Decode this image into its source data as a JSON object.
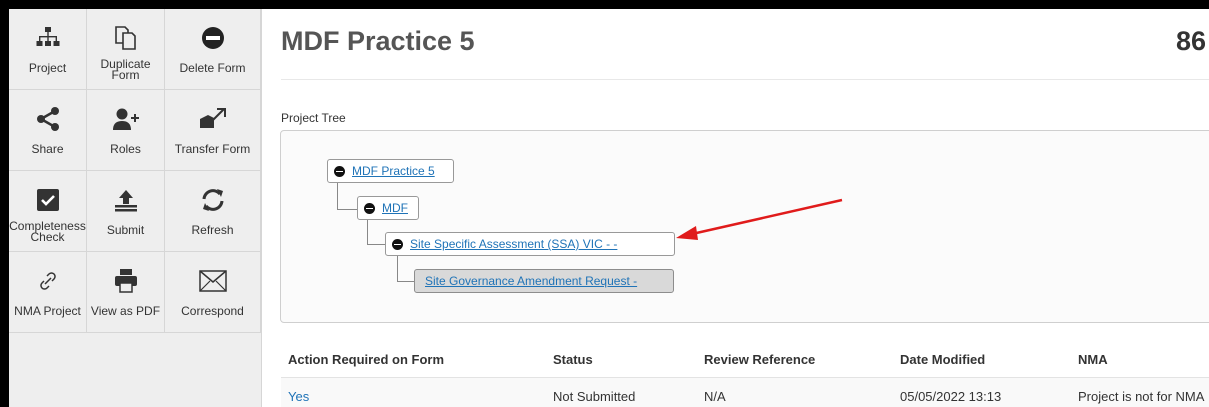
{
  "toolbar": {
    "project": "Project",
    "duplicate_line1": "Duplicate",
    "duplicate_line2": "Form",
    "delete_form": "Delete Form",
    "share": "Share",
    "roles": "Roles",
    "transfer_form": "Transfer Form",
    "completeness_line1": "Completeness",
    "completeness_line2": "Check",
    "submit": "Submit",
    "refresh": "Refresh",
    "nma_project": "NMA Project",
    "view_as_pdf": "View as PDF",
    "correspond": "Correspond"
  },
  "header": {
    "title": "MDF Practice 5",
    "number_partial": "86"
  },
  "project_tree": {
    "label": "Project Tree",
    "nodes": [
      {
        "label": "MDF Practice 5"
      },
      {
        "label": "MDF"
      },
      {
        "label": "Site Specific Assessment (SSA) VIC - -"
      },
      {
        "label": "Site Governance Amendment Request -"
      }
    ]
  },
  "table": {
    "headers": [
      "Action Required on Form",
      "Status",
      "Review Reference",
      "Date Modified",
      "NMA"
    ],
    "rows": [
      [
        "Yes",
        "Not Submitted",
        "N/A",
        "05/05/2022 13:13",
        "Project is not for NMA"
      ]
    ]
  },
  "colors": {
    "link": "#1f73b7",
    "annotation_arrow": "#e01b1b",
    "toolbar_bg": "#eeeeee"
  }
}
